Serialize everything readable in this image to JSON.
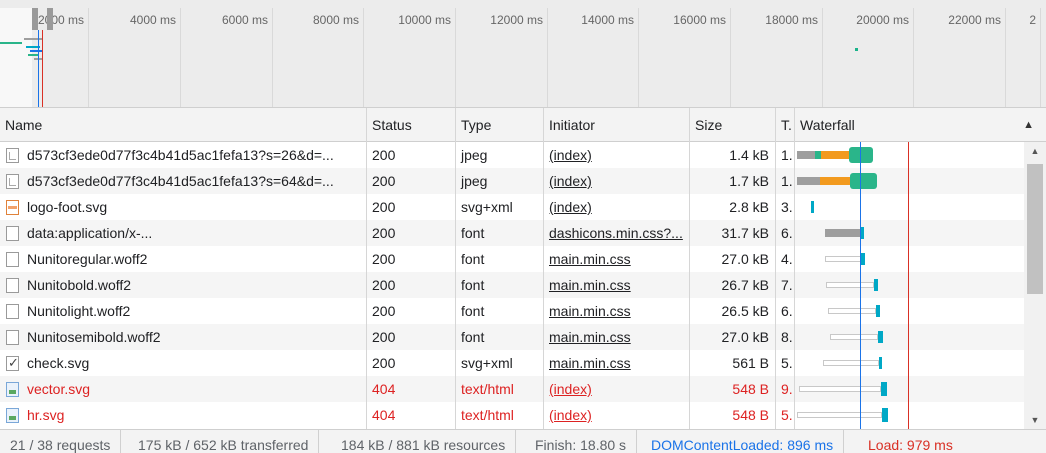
{
  "overview": {
    "ticks": [
      {
        "label": "2000 ms"
      },
      {
        "label": "4000 ms"
      },
      {
        "label": "6000 ms"
      },
      {
        "label": "8000 ms"
      },
      {
        "label": "10000 ms"
      },
      {
        "label": "12000 ms"
      },
      {
        "label": "14000 ms"
      },
      {
        "label": "16000 ms"
      },
      {
        "label": "18000 ms"
      },
      {
        "label": "20000 ms"
      },
      {
        "label": "22000 ms"
      },
      {
        "label": "2"
      }
    ]
  },
  "columns": {
    "name": "Name",
    "status": "Status",
    "type": "Type",
    "initiator": "Initiator",
    "size": "Size",
    "time": "T.",
    "waterfall": "Waterfall"
  },
  "rows": [
    {
      "name": "d573cf3ede0d77f3c4b41d5ac1fefa13?s=26&d=...",
      "status": "200",
      "type": "jpeg",
      "initiator": "(index)",
      "size": "1.4 kB",
      "time": "1.",
      "icon": "image-file-icon",
      "error": false
    },
    {
      "name": "d573cf3ede0d77f3c4b41d5ac1fefa13?s=64&d=...",
      "status": "200",
      "type": "jpeg",
      "initiator": "(index)",
      "size": "1.7 kB",
      "time": "1.",
      "icon": "image-file-icon",
      "error": false
    },
    {
      "name": "logo-foot.svg",
      "status": "200",
      "type": "svg+xml",
      "initiator": "(index)",
      "size": "2.8 kB",
      "time": "3.",
      "icon": "svg-file-icon",
      "error": false
    },
    {
      "name": "data:application/x-...",
      "status": "200",
      "type": "font",
      "initiator": "dashicons.min.css?...",
      "size": "31.7 kB",
      "time": "6.",
      "icon": "file-icon",
      "error": false
    },
    {
      "name": "Nunitoregular.woff2",
      "status": "200",
      "type": "font",
      "initiator": "main.min.css",
      "size": "27.0 kB",
      "time": "4.",
      "icon": "file-icon",
      "error": false
    },
    {
      "name": "Nunitobold.woff2",
      "status": "200",
      "type": "font",
      "initiator": "main.min.css",
      "size": "26.7 kB",
      "time": "7.",
      "icon": "file-icon",
      "error": false
    },
    {
      "name": "Nunitolight.woff2",
      "status": "200",
      "type": "font",
      "initiator": "main.min.css",
      "size": "26.5 kB",
      "time": "6.",
      "icon": "file-icon",
      "error": false
    },
    {
      "name": "Nunitosemibold.woff2",
      "status": "200",
      "type": "font",
      "initiator": "main.min.css",
      "size": "27.0 kB",
      "time": "8.",
      "icon": "file-icon",
      "error": false
    },
    {
      "name": "check.svg",
      "status": "200",
      "type": "svg+xml",
      "initiator": "main.min.css",
      "size": "561 B",
      "time": "5.",
      "icon": "checkmark-file-icon",
      "error": false
    },
    {
      "name": "vector.svg",
      "status": "404",
      "type": "text/html",
      "initiator": "(index)",
      "size": "548 B",
      "time": "9.",
      "icon": "broken-image-icon",
      "error": true
    },
    {
      "name": "hr.svg",
      "status": "404",
      "type": "text/html",
      "initiator": "(index)",
      "size": "548 B",
      "time": "5.",
      "icon": "broken-image-icon",
      "error": true
    }
  ],
  "status_bar": {
    "requests": "21 / 38 requests",
    "transferred": "175 kB / 652 kB transferred",
    "resources": "184 kB / 881 kB resources",
    "finish": "Finish: 18.80 s",
    "dom": "DOMContentLoaded: 896 ms",
    "load": "Load: 979 ms"
  },
  "colors": {
    "error": "#dd2222",
    "dom_line": "#1a73e8",
    "load_line": "#d93025",
    "wf_waiting": "#2ab58a",
    "wf_download": "#00a8c6",
    "wf_queue": "#9e9e9e",
    "wf_stall": "#f29a1e"
  }
}
